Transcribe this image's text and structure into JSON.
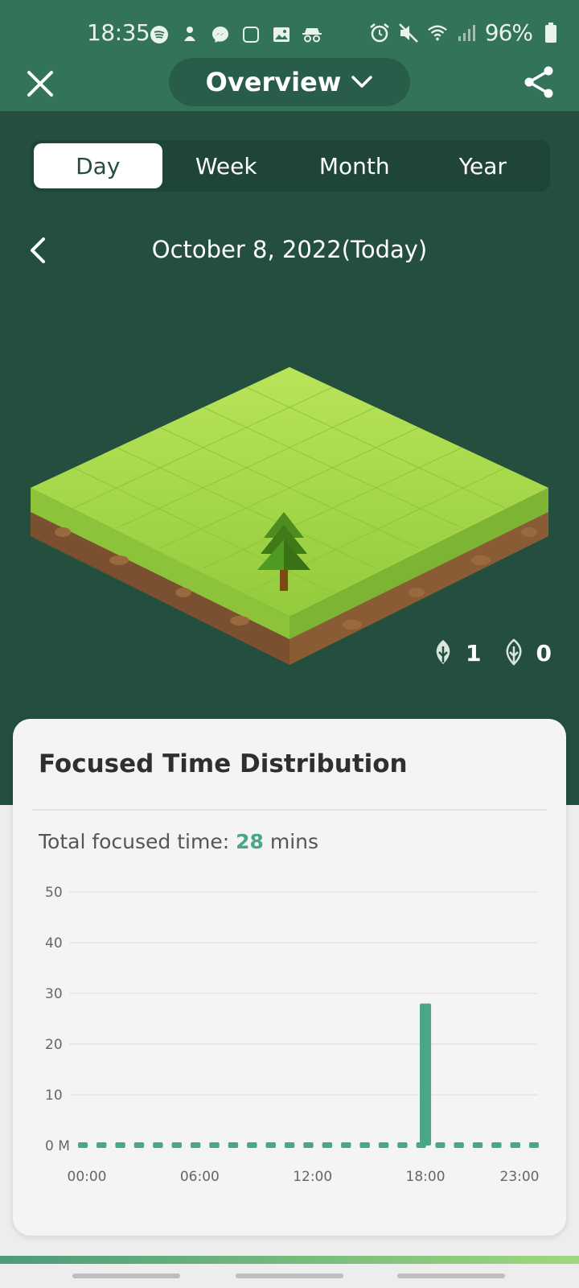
{
  "status_bar": {
    "time": "18:35",
    "battery_text": "96%",
    "left_icons": [
      "spotify-icon",
      "notification-icon",
      "messenger-icon",
      "square-icon",
      "gallery-icon",
      "incognito-icon"
    ],
    "right_icons": [
      "alarm-icon",
      "mute-icon",
      "wifi-icon",
      "signal-icon",
      "battery-icon"
    ]
  },
  "topbar": {
    "title": "Overview"
  },
  "tabs": [
    {
      "label": "Day",
      "active": true
    },
    {
      "label": "Week",
      "active": false
    },
    {
      "label": "Month",
      "active": false
    },
    {
      "label": "Year",
      "active": false
    }
  ],
  "date_label": "October 8, 2022(Today)",
  "counts": {
    "healthy": "1",
    "withered": "0"
  },
  "card": {
    "title": "Focused Time Distribution",
    "total_label": "Total focused time: ",
    "total_value": "28",
    "total_unit": " mins"
  },
  "colors": {
    "header": "#244f3e",
    "topbar": "#33735a",
    "accent": "#4aa784"
  },
  "chart_data": {
    "type": "bar",
    "y_tick_labels": [
      "0 M",
      "10",
      "20",
      "30",
      "40",
      "50"
    ],
    "y_ticks": [
      0,
      10,
      20,
      30,
      40,
      50
    ],
    "ylim": [
      0,
      50
    ],
    "x_tick_labels": [
      "00:00",
      "06:00",
      "12:00",
      "18:00",
      "23:00"
    ],
    "categories": [
      "00",
      "01",
      "02",
      "03",
      "04",
      "05",
      "06",
      "07",
      "08",
      "09",
      "10",
      "11",
      "12",
      "13",
      "14",
      "15",
      "16",
      "17",
      "18",
      "19",
      "20",
      "21",
      "22",
      "23"
    ],
    "values": [
      0,
      0,
      0,
      0,
      0,
      0,
      0,
      0,
      0,
      0,
      0,
      0,
      0,
      0,
      0,
      0,
      0,
      0,
      28,
      0,
      0,
      0,
      0,
      0
    ]
  }
}
